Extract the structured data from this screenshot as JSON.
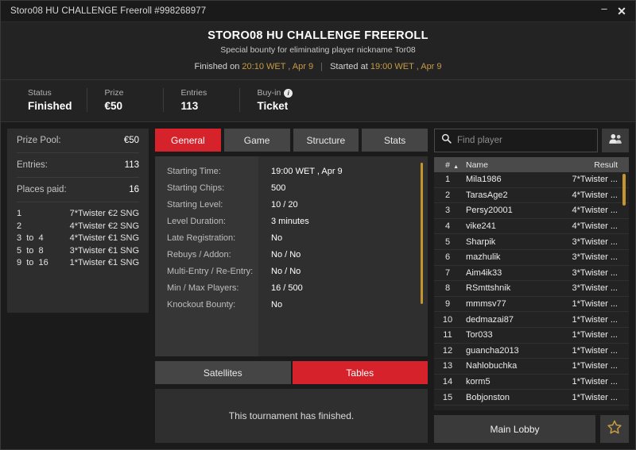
{
  "window": {
    "titlebar_text": "Storo08 HU CHALLENGE Freeroll #998268977",
    "minimize_label": "–",
    "close_label": "✕"
  },
  "header": {
    "title": "STORO08 HU CHALLENGE FREEROLL",
    "subtitle": "Special bounty for eliminating player nickname Tor08",
    "finished_prefix": "Finished on",
    "finished_time": "20:10 WET , Apr 9",
    "divider": "|",
    "started_prefix": "Started at",
    "started_time": "19:00 WET , Apr 9"
  },
  "status": {
    "items": [
      {
        "label": "Status",
        "value": "Finished"
      },
      {
        "label": "Prize",
        "value": "€50"
      },
      {
        "label": "Entries",
        "value": "113"
      },
      {
        "label": "Buy-in",
        "value": "Ticket",
        "has_info": true,
        "info_glyph": "i"
      }
    ]
  },
  "prize_panel": {
    "rows": [
      {
        "key": "Prize Pool:",
        "value": "€50"
      },
      {
        "key": "Entries:",
        "value": "113"
      },
      {
        "key": "Places paid:",
        "value": "16"
      }
    ],
    "payouts": [
      {
        "place": "1",
        "prize": "7*Twister €2 SNG"
      },
      {
        "place": "2",
        "prize": "4*Twister €2 SNG"
      },
      {
        "place": "3  to  4",
        "prize": "4*Twister €1 SNG"
      },
      {
        "place": "5  to  8",
        "prize": "3*Twister €1 SNG"
      },
      {
        "place": "9  to  16",
        "prize": "1*Twister €1 SNG"
      }
    ]
  },
  "tabs": {
    "items": [
      {
        "label": "General",
        "active": true
      },
      {
        "label": "Game",
        "active": false
      },
      {
        "label": "Structure",
        "active": false
      },
      {
        "label": "Stats",
        "active": false
      }
    ]
  },
  "general": {
    "rows": [
      {
        "label": "Starting Time:",
        "value": "19:00 WET , Apr 9"
      },
      {
        "label": "Starting Chips:",
        "value": "500"
      },
      {
        "label": "Starting Level:",
        "value": "10 / 20"
      },
      {
        "label": "Level Duration:",
        "value": "3 minutes"
      },
      {
        "label": "Late Registration:",
        "value": "No"
      },
      {
        "label": "Rebuys / Addon:",
        "value": "No / No"
      },
      {
        "label": "Multi-Entry / Re-Entry:",
        "value": "No / No"
      },
      {
        "label": "Min / Max Players:",
        "value": "16 / 500"
      },
      {
        "label": "Knockout Bounty:",
        "value": "No"
      }
    ]
  },
  "sub_tabs": {
    "items": [
      {
        "label": "Satellites",
        "active": false
      },
      {
        "label": "Tables",
        "active": true
      }
    ],
    "empty_message": "This tournament has finished."
  },
  "search": {
    "placeholder": "Find player",
    "value": "",
    "icon": "search-icon",
    "people_icon": "people-icon"
  },
  "players": {
    "columns": {
      "num": "#",
      "sort_caret": "▲",
      "name": "Name",
      "result": "Result"
    },
    "rows": [
      {
        "num": "1",
        "name": "Mila1986",
        "result": "7*Twister ..."
      },
      {
        "num": "2",
        "name": "TarasAge2",
        "result": "4*Twister ..."
      },
      {
        "num": "3",
        "name": "Persy20001",
        "result": "4*Twister ..."
      },
      {
        "num": "4",
        "name": "vike241",
        "result": "4*Twister ..."
      },
      {
        "num": "5",
        "name": "Sharpik",
        "result": "3*Twister ..."
      },
      {
        "num": "6",
        "name": "mazhulik",
        "result": "3*Twister ..."
      },
      {
        "num": "7",
        "name": "Aim4ik33",
        "result": "3*Twister ..."
      },
      {
        "num": "8",
        "name": "RSmttshnik",
        "result": "3*Twister ..."
      },
      {
        "num": "9",
        "name": "mmmsv77",
        "result": "1*Twister ..."
      },
      {
        "num": "10",
        "name": "dedmazai87",
        "result": "1*Twister ..."
      },
      {
        "num": "11",
        "name": "Tor033",
        "result": "1*Twister ..."
      },
      {
        "num": "12",
        "name": "guancha2013",
        "result": "1*Twister ..."
      },
      {
        "num": "13",
        "name": "Nahlobuchka",
        "result": "1*Twister ..."
      },
      {
        "num": "14",
        "name": "korm5",
        "result": "1*Twister ..."
      },
      {
        "num": "15",
        "name": "Bobjonston",
        "result": "1*Twister ..."
      }
    ]
  },
  "footer": {
    "main_lobby_label": "Main Lobby",
    "favorite_icon": "star-icon"
  },
  "colors": {
    "accent_red": "#d6222a",
    "gold": "#c89b44",
    "panel": "#2f2f2f",
    "window_bg": "#232323"
  }
}
